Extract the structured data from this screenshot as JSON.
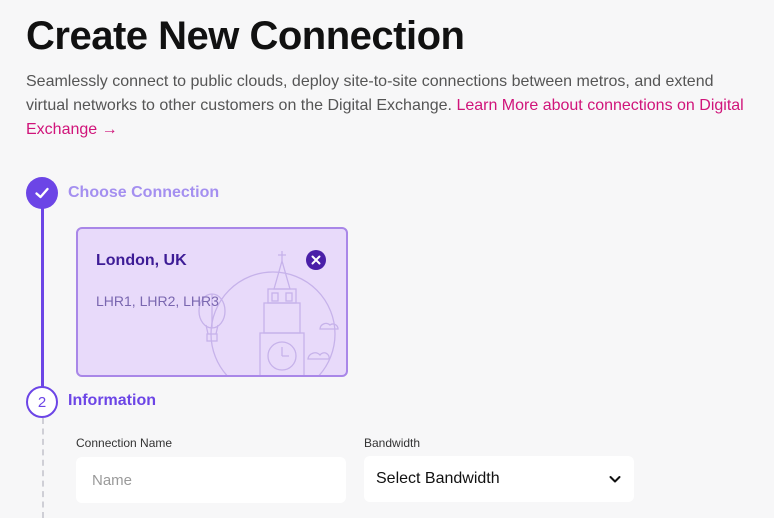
{
  "header": {
    "title": "Create New Connection",
    "intro": "Seamlessly connect to public clouds, deploy site-to-site connections between metros, and extend virtual networks to other customers on the Digital Exchange.",
    "learn_more_link": "Learn More about connections on Digital Exchange →"
  },
  "steps": [
    {
      "number": "1",
      "title": "Choose Connection",
      "status": "complete"
    },
    {
      "number": "2",
      "title": "Information",
      "status": "active"
    }
  ],
  "location_card": {
    "city": "London, UK",
    "codes": "LHR1, LHR2, LHR3"
  },
  "form": {
    "connection_name_label": "Connection Name",
    "connection_name_placeholder": "Name",
    "connection_name_value": "",
    "bandwidth_label": "Bandwidth",
    "bandwidth_value": "Select Bandwidth"
  },
  "colors": {
    "accent": "#6c45e6",
    "link": "#d0147a",
    "card_bg": "#e8dafa"
  }
}
